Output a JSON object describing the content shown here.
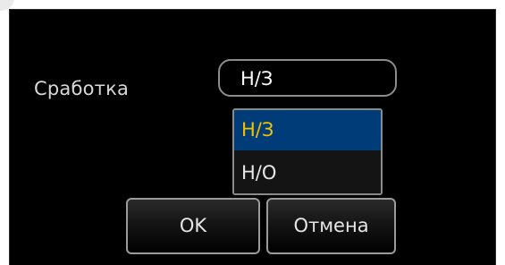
{
  "dialog": {
    "field_label": "Сработка",
    "select": {
      "value": "Н/З",
      "options": [
        {
          "label": "Н/З",
          "selected": true
        },
        {
          "label": "Н/О",
          "selected": false
        }
      ]
    },
    "buttons": {
      "ok_label": "OK",
      "cancel_label": "Отмена"
    }
  },
  "colors": {
    "dialog_background": "#000000",
    "selected_option_background": "#003c78",
    "selected_option_text": "#f2c200",
    "option_text": "#e8e8e8",
    "border": "#8c8c8c"
  }
}
